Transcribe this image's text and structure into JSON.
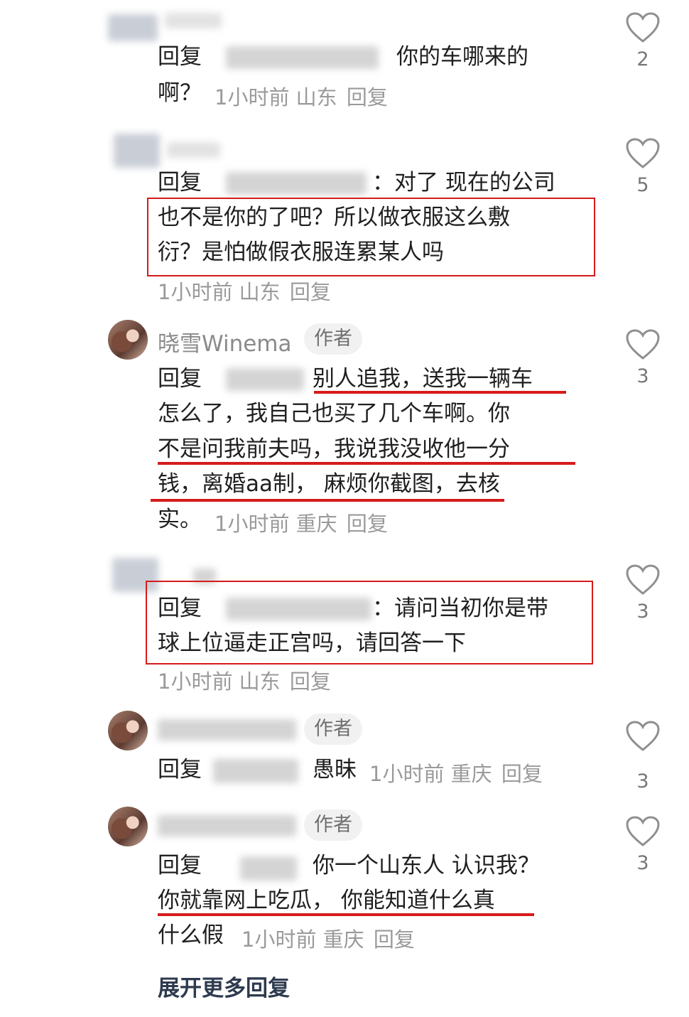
{
  "comments": [
    {
      "lines": [
        "回复",
        "你的车哪来的",
        "啊？"
      ],
      "time": "1小时前",
      "location": "山东",
      "reply": "回复",
      "likes": "2"
    },
    {
      "lines": [
        "回复",
        "：对了 现在的公司",
        "也不是你的了吧？所以做衣服这么敷",
        "衍？是怕做假衣服连累某人吗"
      ],
      "time": "1小时前",
      "location": "山东",
      "reply": "回复",
      "likes": "5"
    },
    {
      "name": "晓雪Winema",
      "badge": "作者",
      "lines": [
        "回复",
        "别人追我，送我一辆车",
        "怎么了，我自己也买了几个车啊。你",
        "不是问我前夫吗，我说我没收他一分",
        "钱，离婚aa制， 麻烦你截图，去核",
        "实。"
      ],
      "time": "1小时前",
      "location": "重庆",
      "reply": "回复",
      "likes": "3"
    },
    {
      "lines": [
        "回复",
        "：请问当初你是带",
        "球上位逼走正宫吗，请回答一下"
      ],
      "time": "1小时前",
      "location": "山东",
      "reply": "回复",
      "likes": "3"
    },
    {
      "badge": "作者",
      "lines": [
        "回复",
        "愚昧"
      ],
      "time": "1小时前",
      "location": "重庆",
      "reply": "回复",
      "likes": "3"
    },
    {
      "badge": "作者",
      "lines": [
        "回复",
        "你一个山东人 认识我？",
        "你就靠网上吃瓜， 你能知道什么真",
        "什么假"
      ],
      "time": "1小时前",
      "location": "重庆",
      "reply": "回复",
      "likes": "3"
    }
  ],
  "expand_more": "展开更多回复",
  "colors": {
    "highlight": "#d61b1b",
    "meta": "#9a9a9a"
  },
  "icons": {
    "like": "heart-outline-icon"
  }
}
